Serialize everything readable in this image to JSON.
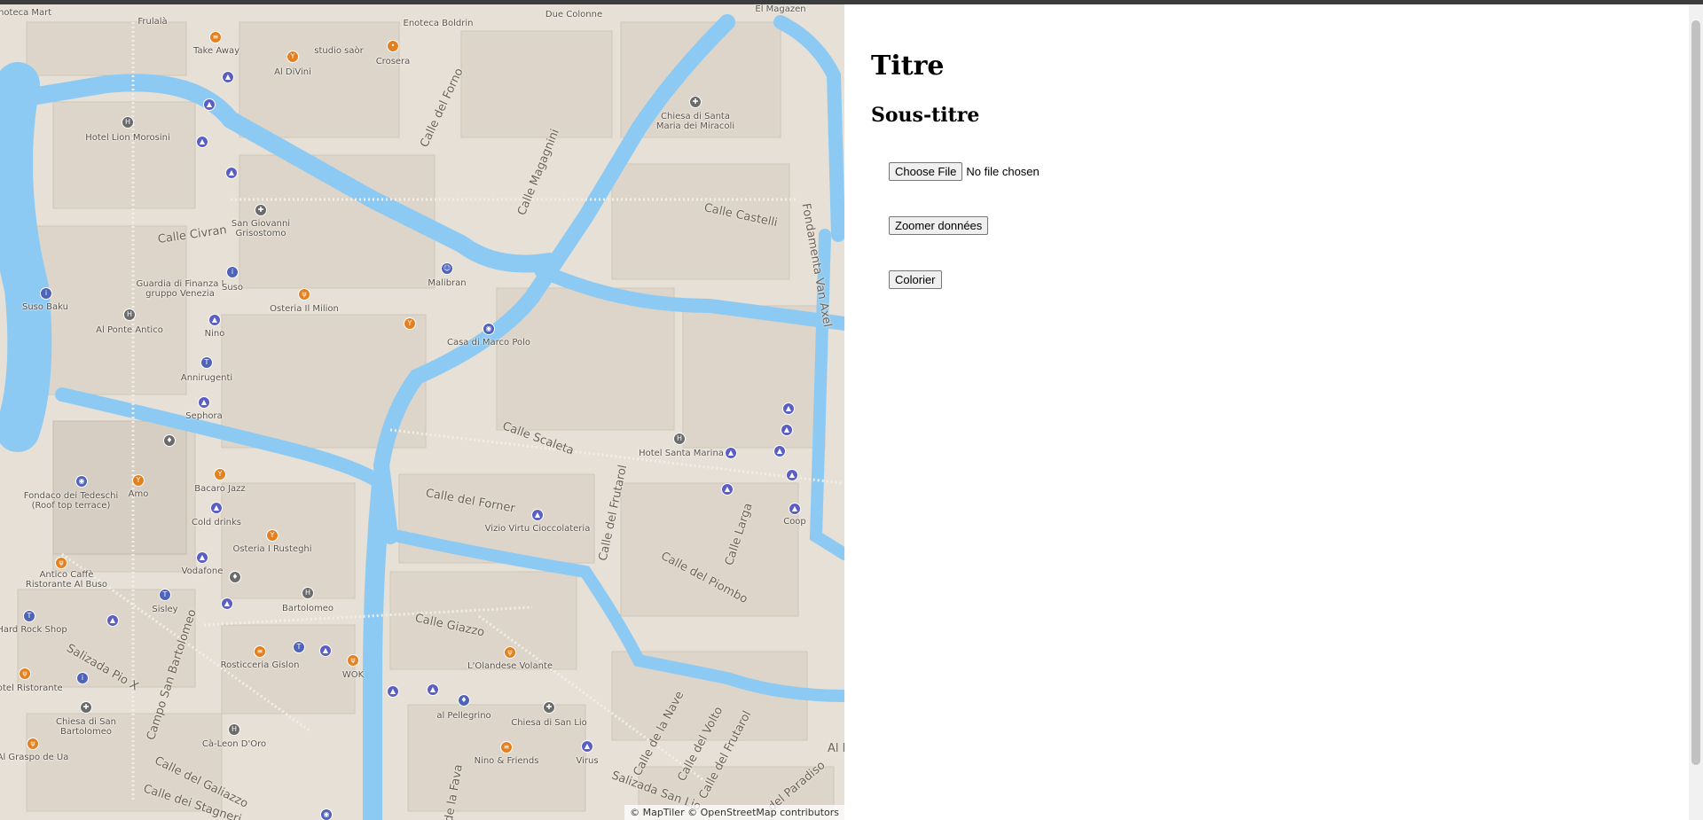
{
  "panel": {
    "title": "Titre",
    "subtitle": "Sous-titre",
    "file_button_label": "Choose File",
    "file_status": "No file chosen",
    "zoom_button_label": "Zoomer données",
    "color_button_label": "Colorier"
  },
  "map": {
    "attribution": "© MapTiler © OpenStreetMap contributors",
    "colors": {
      "land": "#e6e0d6",
      "water": "#8ccaf4",
      "building": "#ddd5c9",
      "road": "#f4f1ec"
    },
    "places": [
      "Frulalà",
      "Enoteca Boldrin",
      "Due Colonne",
      "El Magazen",
      "Take Away",
      "studio saòr",
      "Al DiVini",
      "Crosera",
      "Hotel Lion Morosini",
      "Chiesa di Santa Maria dei Miracoli",
      "San Giovanni Grisostomo",
      "Malibran",
      "Guardia di Finanza I gruppo Venezia",
      "Suso",
      "Suso Baku",
      "Osteria Il Milion",
      "Al Ponte Antico",
      "Nino",
      "Casa di Marco Polo",
      "Annirugenti",
      "Sephora",
      "Hotel Santa Marina",
      "Coop",
      "Fondaco dei Tedeschi (Roof top terrace)",
      "Amo",
      "Bacaro Jazz",
      "Cold drinks",
      "Osteria I Rusteghi",
      "Vizio Virtu Cioccolateria",
      "Antico Caffè Ristorante Al Buso",
      "Vodafone",
      "Sisley",
      "Bartolomeo",
      "Hard Rock Shop",
      "Rosticceria Gislon",
      "WOK",
      "L'Olandese Volante",
      "Hotel Ristorante",
      "Chiesa di San Bartolomeo",
      "al Pellegrino",
      "Chiesa di San Lio",
      "Cà-Leon D'Oro",
      "Virus",
      "Nino & Friends",
      "Al Graspo de Ua",
      "Enoteca Mart"
    ],
    "streets": [
      "Calle del Forno",
      "Calle Magagnini",
      "Calle Castelli",
      "Fondamenta Van Axel",
      "Calle Civran",
      "Calle Scaleta",
      "Calle del Forner",
      "Calle del Frutarol",
      "Calle Larga",
      "Calle del Piombo",
      "Calle Giazzo",
      "Campo San Bartolomeo",
      "Salizada Pio X",
      "Calle del Galiazzo",
      "Calle dei Stagneri",
      "de la Fava",
      "Salizada San Lio",
      "Calle de la Nave",
      "Calle del Volto",
      "Calle del Frutarol",
      "del Paradiso",
      "Al Bo"
    ]
  }
}
